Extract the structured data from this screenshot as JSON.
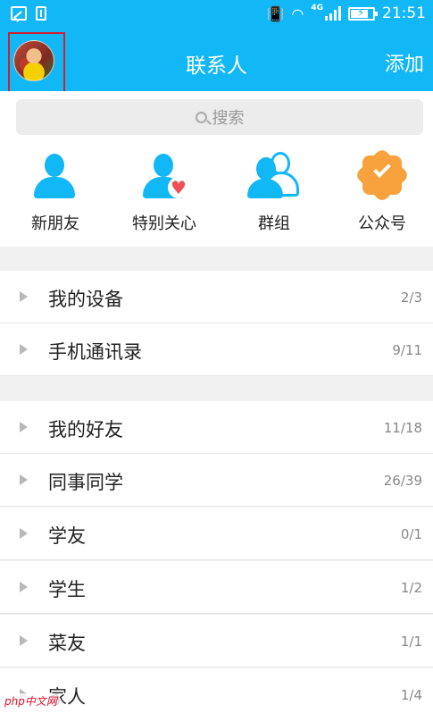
{
  "status_bar": {
    "time": "21:51",
    "network": "4G",
    "battery_level": 0.8
  },
  "header": {
    "title": "联系人",
    "add_label": "添加"
  },
  "search": {
    "placeholder": "搜索"
  },
  "quick_actions": [
    {
      "label": "新朋友",
      "icon": "new-friend-icon"
    },
    {
      "label": "特别关心",
      "icon": "special-care-icon"
    },
    {
      "label": "群组",
      "icon": "group-icon"
    },
    {
      "label": "公众号",
      "icon": "official-account-icon"
    }
  ],
  "groups": [
    {
      "name": "我的设备",
      "count": "2/3"
    },
    {
      "name": "手机通讯录",
      "count": "9/11"
    },
    {
      "name": "我的好友",
      "count": "11/18"
    },
    {
      "name": "同事同学",
      "count": "26/39"
    },
    {
      "name": "学友",
      "count": "0/1"
    },
    {
      "name": "学生",
      "count": "1/2"
    },
    {
      "name": "菜友",
      "count": "1/1"
    },
    {
      "name": "家人",
      "count": "1/4"
    }
  ],
  "watermark": "php中文网",
  "colors": {
    "accent": "#12b7f5",
    "heart": "#ef5057",
    "badge": "#f7a23c",
    "avatar_highlight": "#d0202e"
  }
}
